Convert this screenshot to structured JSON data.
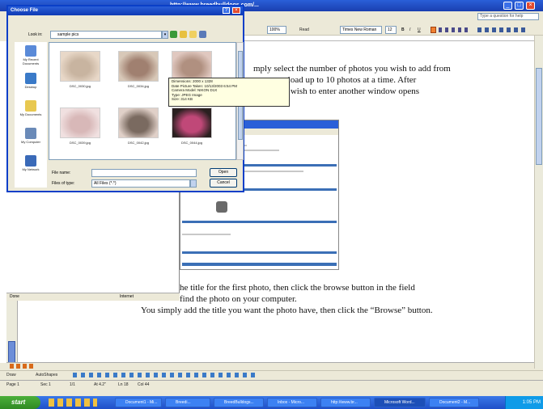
{
  "word": {
    "title": "http://www.breedbulldogs.com/...",
    "help_placeholder": "Type a question for help",
    "zoom": "100%",
    "read_label": "Read",
    "font": "Times New Roman",
    "size": "12"
  },
  "doc": {
    "lines": [
      "mply select the number of photos you wish to add from",
      "ou can upload up to 10 photos at a time.  After",
      "hotos you wish to enter another window opens",
      "he title for the first photo, then click the browse button in the field",
      "find the photo on your computer.",
      "You simply add the title you want the photo have, then click the “Browse” button."
    ]
  },
  "browser_status": {
    "done": "Done",
    "zone": "Internet"
  },
  "statusbar": {
    "page": "Page 1",
    "sec": "Sec 1",
    "pages": "1/1",
    "at": "At 4.2\"",
    "ln": "Ln 18",
    "col": "Col 44"
  },
  "drawbar": {
    "draw": "Draw",
    "autoshapes": "AutoShapes"
  },
  "taskbar": {
    "start": "start",
    "tasks": [
      "Document1 - Mi...",
      "Breedi...",
      "BreedBulldogs...",
      "Inbox - Micro...",
      "http://www.br...",
      "Microsoft Word...",
      "Document2 - M..."
    ],
    "clock": "1:05 PM"
  },
  "dialog": {
    "title": "Choose File",
    "look_in_label": "Look in:",
    "look_in_value": "sample pics",
    "places": [
      "My Recent Documents",
      "Desktop",
      "My Documents",
      "My Computer",
      "My Network"
    ],
    "files": [
      {
        "name": "DSC_0030.jpg",
        "colors": [
          "#c8b4a0",
          "#e8d8c8"
        ]
      },
      {
        "name": "DSC_0034.jpg",
        "colors": [
          "#a08070",
          "#d8c8b8"
        ]
      },
      {
        "name": "DSC_0037.jpg",
        "colors": [
          "#b09080",
          "#e0c8c0"
        ]
      },
      {
        "name": "DSC_0039.jpg",
        "colors": [
          "#d8b8b8",
          "#f0e0e0"
        ]
      },
      {
        "name": "DSC_0042.jpg",
        "colors": [
          "#7a6a60",
          "#e0d0c8"
        ]
      },
      {
        "name": "DSC_0044.jpg",
        "colors": [
          "#c04878",
          "#2a2020"
        ]
      }
    ],
    "tooltip": [
      "Dimensions: 2000 x 1328",
      "Date Picture Taken: 10/13/2003 6:54 PM",
      "Camera Model: NIKON D1X",
      "Type: JPEG Image",
      "Size: 314 KB"
    ],
    "file_name_label": "File name:",
    "file_name_value": "",
    "file_type_label": "Files of type:",
    "file_type_value": "All Files (*.*)",
    "open_label": "Open",
    "cancel_label": "Cancel"
  }
}
